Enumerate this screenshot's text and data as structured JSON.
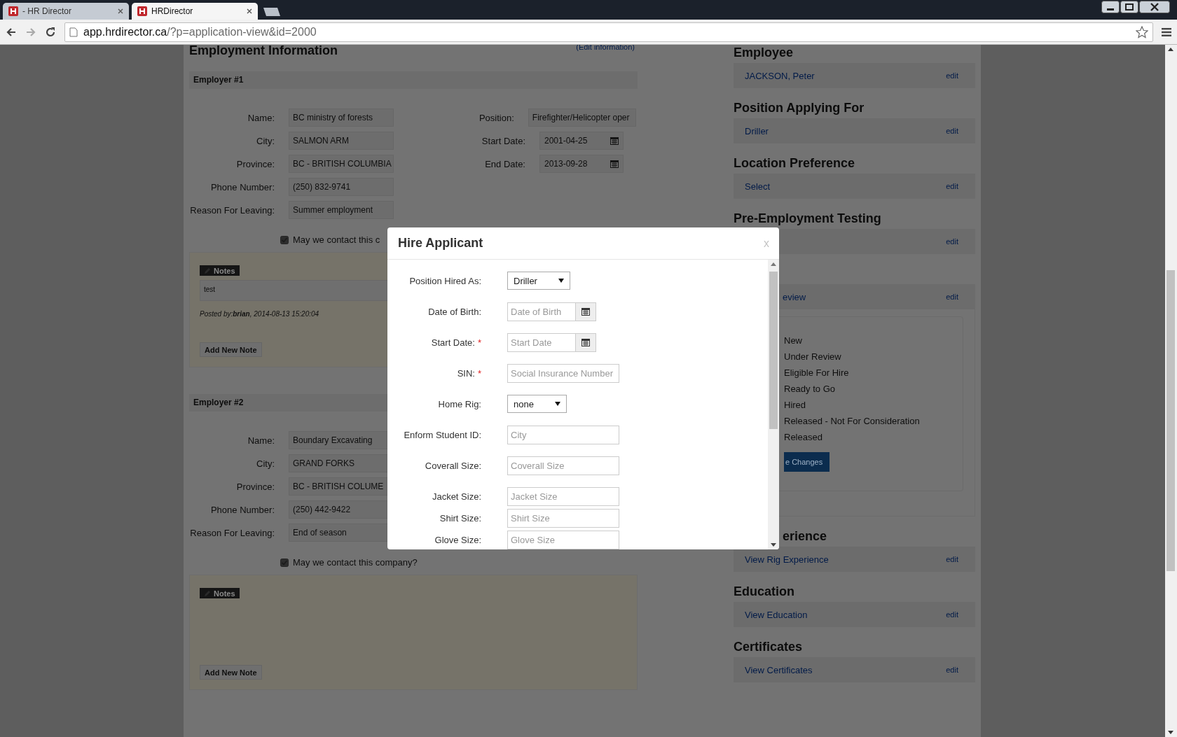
{
  "browser": {
    "tabs": [
      {
        "title": "- HR Director",
        "selected": false
      },
      {
        "title": "HRDirector",
        "selected": true
      }
    ],
    "url_host": "app.hrdirector.ca",
    "url_path": "/?p=application-view&id=2000"
  },
  "employment": {
    "title": "Employment Information",
    "edit_link": "(Edit information)",
    "employers": [
      {
        "title": "Employer #1",
        "fields": [
          {
            "label": "Name:",
            "value": "BC ministry of forests"
          },
          {
            "label": "City:",
            "value": "SALMON ARM"
          },
          {
            "label": "Province:",
            "value": "BC - BRITISH COLUMBIA"
          },
          {
            "label": "Phone Number:",
            "value": "(250) 832-9741"
          },
          {
            "label": "Reason For Leaving:",
            "value": "Summer employment"
          }
        ],
        "fields_right": [
          {
            "label": "Position:",
            "value": "Firefighter/Helicopter oper",
            "kind": "text"
          },
          {
            "label": "Start Date:",
            "value": "2001-04-25",
            "kind": "date"
          },
          {
            "label": "End Date:",
            "value": "2013-09-28",
            "kind": "date"
          }
        ],
        "contact": {
          "label": "May we contact this c",
          "checked": true
        },
        "notes_badge": "Notes",
        "notes": [
          {
            "text": "test",
            "posted": "Posted by:**brian**, 2014-08-13 15:20:04"
          }
        ],
        "add_note": "Add New Note"
      },
      {
        "title": "Employer #2",
        "fields": [
          {
            "label": "Name:",
            "value": "Boundary Excavating"
          },
          {
            "label": "City:",
            "value": "GRAND FORKS"
          },
          {
            "label": "Province:",
            "value": "BC - BRITISH COLUME"
          },
          {
            "label": "Phone Number:",
            "value": "(250) 442-9422"
          },
          {
            "label": "Reason For Leaving:",
            "value": "End of season"
          }
        ],
        "contact": {
          "label": "May we contact this company?",
          "checked": true
        },
        "notes_badge": "Notes",
        "add_note": "Add New Note"
      }
    ]
  },
  "sidebar": {
    "sections": [
      {
        "kind": "link",
        "title": "Employee",
        "link": "JACKSON, Peter",
        "edit": "edit"
      },
      {
        "kind": "link",
        "title": "Position Applying For",
        "link": "Driller",
        "edit": "edit"
      },
      {
        "kind": "link",
        "title": "Location Preference",
        "link": "Select",
        "edit": "edit"
      },
      {
        "kind": "link",
        "title": "Pre-Employment Testing",
        "edit": "edit"
      },
      {
        "kind": "status",
        "link": "eview",
        "edit": "edit",
        "statuses": [
          "New",
          "Under Review",
          "Eligible For Hire",
          "Ready to Go",
          "Hired",
          "Released - Not For Consideration",
          "Released"
        ],
        "save": "e Changes"
      },
      {
        "kind": "link",
        "title": "erience",
        "link": "View Rig Experience",
        "edit": "edit"
      },
      {
        "kind": "link",
        "title": "Education",
        "link": "View Education",
        "edit": "edit"
      },
      {
        "kind": "link",
        "title": "Certificates",
        "link": "View Certificates",
        "edit": "edit"
      }
    ]
  },
  "dialog": {
    "title": "Hire Applicant",
    "close": "x",
    "required_mark": "*",
    "fields": [
      {
        "label": "Position Hired As:",
        "kind": "select",
        "value": "Driller",
        "required": false
      },
      {
        "label": "Date of Birth:",
        "kind": "date",
        "placeholder": "Date of Birth",
        "required": false
      },
      {
        "label": "Start Date:",
        "kind": "date",
        "placeholder": "Start Date",
        "required": true
      },
      {
        "label": "SIN:",
        "kind": "text",
        "placeholder": "Social Insurance Number",
        "required": true
      },
      {
        "label": "Home Rig:",
        "kind": "select",
        "value": "none",
        "required": false
      },
      {
        "label": "Enform Student ID:",
        "kind": "text",
        "placeholder": "City",
        "required": false
      },
      {
        "label": "Coverall Size:",
        "kind": "text",
        "placeholder": "Coverall Size",
        "required": false
      },
      {
        "label": "Jacket Size:",
        "kind": "text",
        "placeholder": "Jacket Size",
        "required": false
      },
      {
        "label": "Shirt Size:",
        "kind": "text",
        "placeholder": "Shirt Size",
        "required": false
      },
      {
        "label": "Glove Size:",
        "kind": "text",
        "placeholder": "Glove Size",
        "required": false
      }
    ]
  }
}
